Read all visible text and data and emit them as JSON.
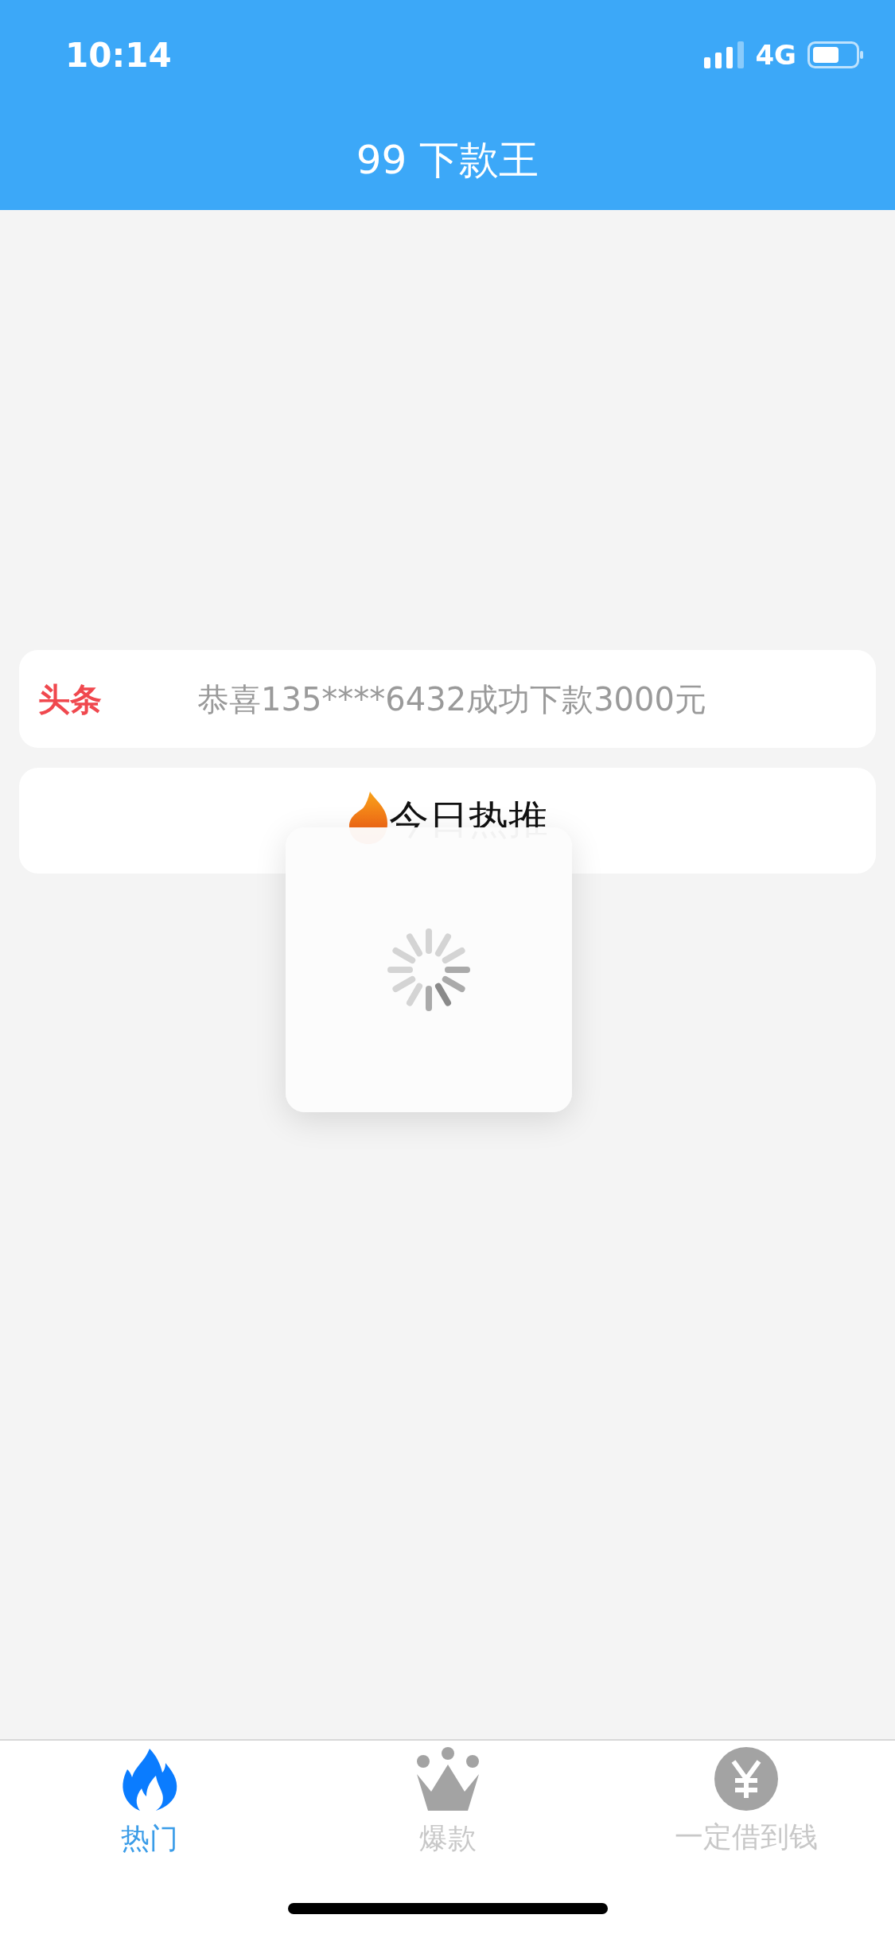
{
  "status_bar": {
    "time": "10:14",
    "network": "4G"
  },
  "header": {
    "title": "99 下款王"
  },
  "headline": {
    "label": "头条",
    "text": "恭喜135****6432成功下款3000元"
  },
  "section": {
    "title": "今日热推"
  },
  "loading": {
    "visible": true
  },
  "tabs": [
    {
      "label": "热门",
      "kind": "flame",
      "selected": true
    },
    {
      "label": "爆款",
      "kind": "crown",
      "selected": false
    },
    {
      "label": "一定借到钱",
      "kind": "yen",
      "selected": false
    }
  ]
}
